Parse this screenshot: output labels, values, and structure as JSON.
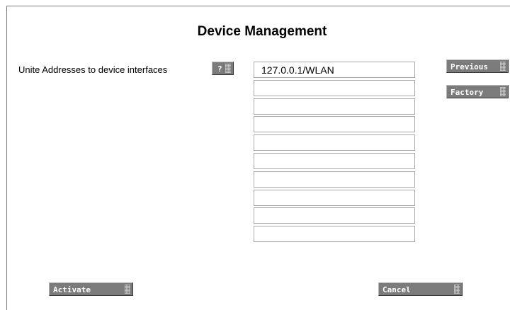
{
  "page": {
    "title": "Device Management",
    "field_label": "Unite Addresses to device interfaces"
  },
  "buttons": {
    "help": "?",
    "previous": "Previous",
    "factory": "Factory",
    "activate": "Activate",
    "cancel": "Cancel"
  },
  "addresses": [
    "127.0.0.1/WLAN",
    "",
    "",
    "",
    "",
    "",
    "",
    "",
    "",
    ""
  ],
  "colors": {
    "button_bg": "#7b7b7b",
    "button_text": "#ffffff",
    "input_border": "#a8a8a8"
  }
}
